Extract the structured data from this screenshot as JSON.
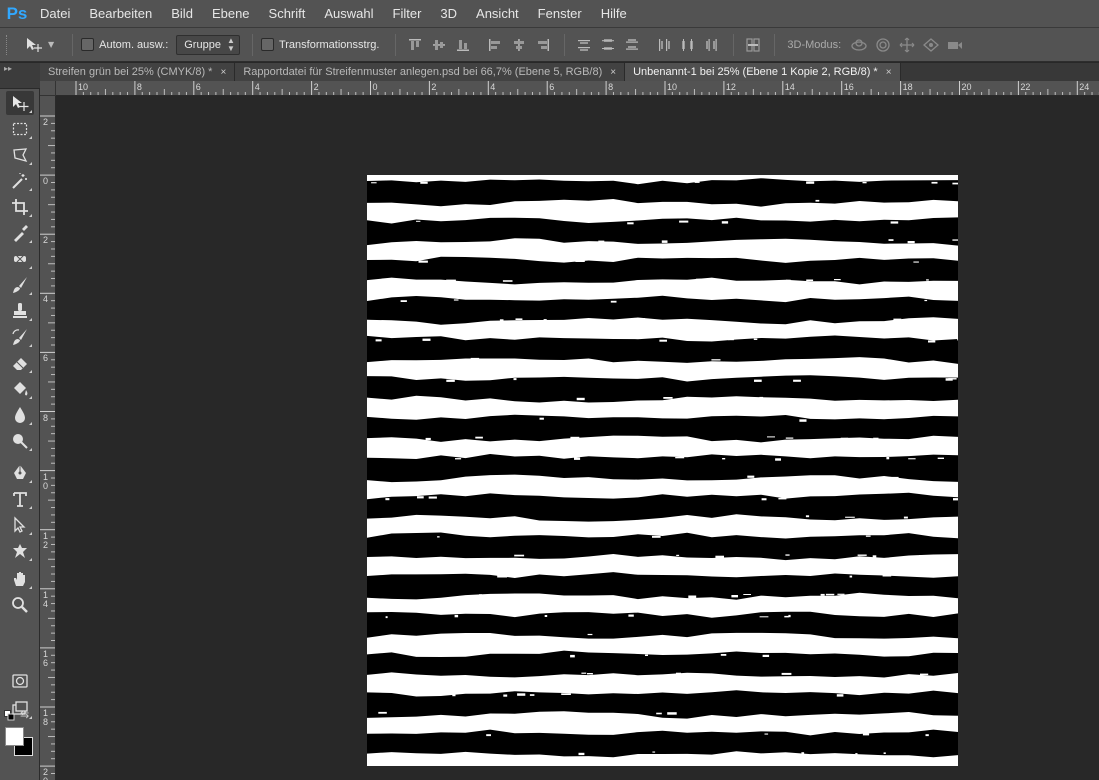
{
  "app": {
    "logo": "Ps"
  },
  "menu": [
    "Datei",
    "Bearbeiten",
    "Bild",
    "Ebene",
    "Schrift",
    "Auswahl",
    "Filter",
    "3D",
    "Ansicht",
    "Fenster",
    "Hilfe"
  ],
  "options": {
    "auto_select_label": "Autom. ausw.:",
    "auto_select_checked": false,
    "auto_select_target": "Gruppe",
    "transform_label": "Transformationsstrg.",
    "transform_checked": false,
    "mode3d_label": "3D-Modus:"
  },
  "tabs": [
    {
      "label": "Streifen grün bei 25% (CMYK/8) *",
      "close": "×",
      "active": false
    },
    {
      "label": "Rapportdatei für Streifenmuster anlegen.psd  bei 66,7% (Ebene 5, RGB/8)",
      "close": "×",
      "active": false
    },
    {
      "label": "Unbenannt-1 bei 25% (Ebene 1 Kopie 2, RGB/8) *",
      "close": "×",
      "active": true
    }
  ],
  "ruler_h": [
    "10",
    "8",
    "6",
    "4",
    "2",
    "0",
    "2",
    "4",
    "6",
    "8",
    "10",
    "12",
    "14",
    "16",
    "18",
    "20",
    "22",
    "24"
  ],
  "ruler_v": [
    "2",
    "0",
    "2",
    "4",
    "6",
    "8",
    "10",
    "12",
    "14",
    "16",
    "18",
    "20"
  ],
  "tools": [
    {
      "icon": "move-tool-icon",
      "active": true
    },
    {
      "icon": "marquee-tool-icon"
    },
    {
      "icon": "lasso-tool-icon"
    },
    {
      "icon": "magic-wand-tool-icon"
    },
    {
      "icon": "crop-tool-icon"
    },
    {
      "icon": "eyedropper-tool-icon"
    },
    {
      "icon": "healing-brush-tool-icon"
    },
    {
      "icon": "brush-tool-icon"
    },
    {
      "icon": "clone-stamp-tool-icon"
    },
    {
      "icon": "history-brush-tool-icon"
    },
    {
      "icon": "eraser-tool-icon"
    },
    {
      "icon": "paint-bucket-tool-icon"
    },
    {
      "icon": "blur-tool-icon"
    },
    {
      "icon": "dodge-tool-icon"
    },
    {
      "icon": "pen-tool-icon"
    },
    {
      "icon": "type-tool-icon"
    },
    {
      "icon": "path-selection-tool-icon"
    },
    {
      "icon": "custom-shape-tool-icon"
    },
    {
      "icon": "hand-tool-icon"
    },
    {
      "icon": "zoom-tool-icon"
    }
  ],
  "colors": {
    "foreground": "#ffffff",
    "background": "#000000",
    "accent": "#31a8ff"
  },
  "document": {
    "pattern": "horizontal-brush-stripes",
    "stripe_color": "#000000",
    "base_color": "#ffffff",
    "stripe_count": 15
  }
}
